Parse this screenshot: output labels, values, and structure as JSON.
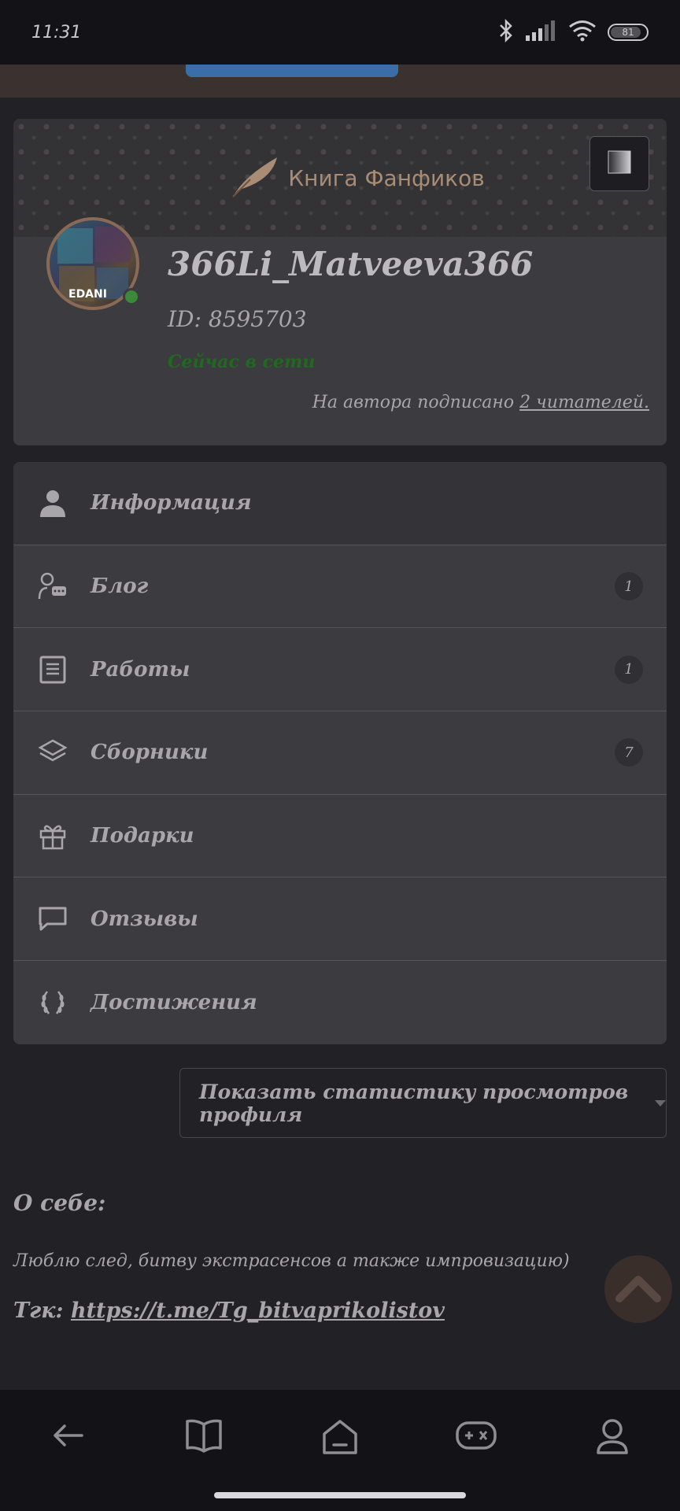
{
  "status_bar": {
    "time": "11:31",
    "battery": "81"
  },
  "banner": {
    "logo_text": "Книга Фанфиков"
  },
  "profile": {
    "username": "366Li_Matveeva366",
    "id_text": "ID: 8595703",
    "online_status": "Сейчас в сети",
    "subscribers_prefix": "На автора подписано",
    "subscribers_link": "2 читателей.",
    "avatar_text": "EDANI"
  },
  "menu": {
    "items": [
      {
        "label": "Информация",
        "icon": "user-icon",
        "badge": ""
      },
      {
        "label": "Блог",
        "icon": "blog-icon",
        "badge": "1"
      },
      {
        "label": "Работы",
        "icon": "document-icon",
        "badge": "1"
      },
      {
        "label": "Сборники",
        "icon": "layers-icon",
        "badge": "7"
      },
      {
        "label": "Подарки",
        "icon": "gift-icon",
        "badge": ""
      },
      {
        "label": "Отзывы",
        "icon": "comment-icon",
        "badge": ""
      },
      {
        "label": "Достижения",
        "icon": "laurel-icon",
        "badge": ""
      }
    ]
  },
  "stats_button": {
    "label": "Показать статистику просмотров профиля"
  },
  "about": {
    "title": "О себе:",
    "text": "Люблю след, битву экстрасенсов а также импровизацию)",
    "link_prefix": "Тгк:",
    "link": "https://t.me/Tg_bitvaprikolistov"
  },
  "colors": {
    "online": "#1f6a1f",
    "card": "#3c3b3f",
    "background": "#222125",
    "accent_logo": "#a98c74"
  }
}
